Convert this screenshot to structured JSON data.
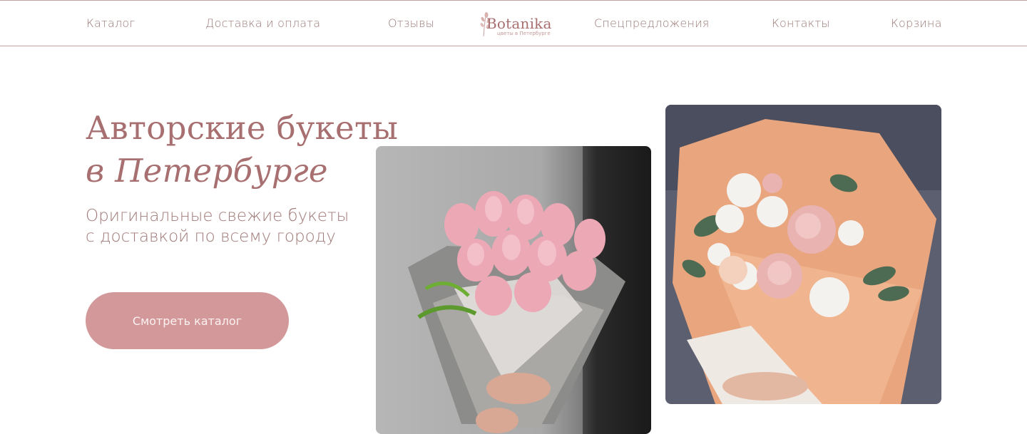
{
  "nav": {
    "catalog": "Каталог",
    "delivery": "Доставка и оплата",
    "reviews": "Отзывы",
    "offers": "Спецпредложения",
    "contacts": "Контакты",
    "cart": "Корзина"
  },
  "logo": {
    "name": "Botanika",
    "tagline": "цветы в Петербурге"
  },
  "hero": {
    "title_line1": "Авторские букеты",
    "title_line2": "в Петербурге",
    "subtitle_line1": "Оригинальные свежие букеты",
    "subtitle_line2": "с доставкой по всему городу",
    "cta_label": "Смотреть каталог"
  },
  "colors": {
    "accent": "#a86f70",
    "button": "#d3999a",
    "border": "#c5a19e"
  },
  "images": {
    "photo1": "pink-tulip-bouquet-photo",
    "photo2": "rose-bouquet-in-peach-paper-photo"
  }
}
